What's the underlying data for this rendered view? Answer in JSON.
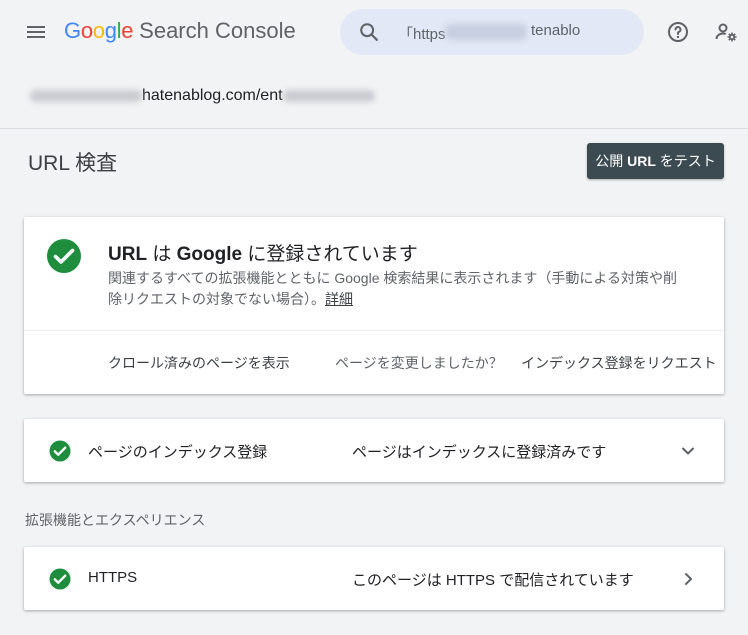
{
  "header": {
    "brand_google": "Google",
    "brand_product": "Search Console",
    "search_value": "「https",
    "search_tail": "tenablo",
    "icons": {
      "menu": "hamburger-menu-icon",
      "search": "search-icon",
      "help": "help-icon",
      "admin": "account-settings-icon"
    }
  },
  "url_bar": {
    "visible_part": "hatenablog.com/ent"
  },
  "page": {
    "title": "URL 検査",
    "test_button_prefix": "公開 ",
    "test_button_bold": "URL",
    "test_button_suffix": " をテスト"
  },
  "main_card": {
    "heading_a": "URL",
    "heading_b": " は ",
    "heading_c": "Google",
    "heading_d": " に登録されています",
    "description": "関連するすべての拡張機能とともに Google 検索結果に表示されます（手動による対策や削除リクエストの対象でない場合）。",
    "details_link": "詳細",
    "actions": [
      "クロール済みのページを表示",
      "ページを変更しましたか？",
      "インデックス登録をリクエスト"
    ]
  },
  "indexing_row": {
    "label": "ページのインデックス登録",
    "status": "ページはインデックスに登録済みです"
  },
  "enhancements": {
    "section_label": "拡張機能とエクスペリエンス",
    "https_label": "HTTPS",
    "https_status": "このページは HTTPS で配信されています"
  },
  "colors": {
    "success_green": "#1e8e3e",
    "button_dark": "#3c4a52",
    "search_bg": "#e2e8f5",
    "page_bg": "#f1f3f4"
  }
}
